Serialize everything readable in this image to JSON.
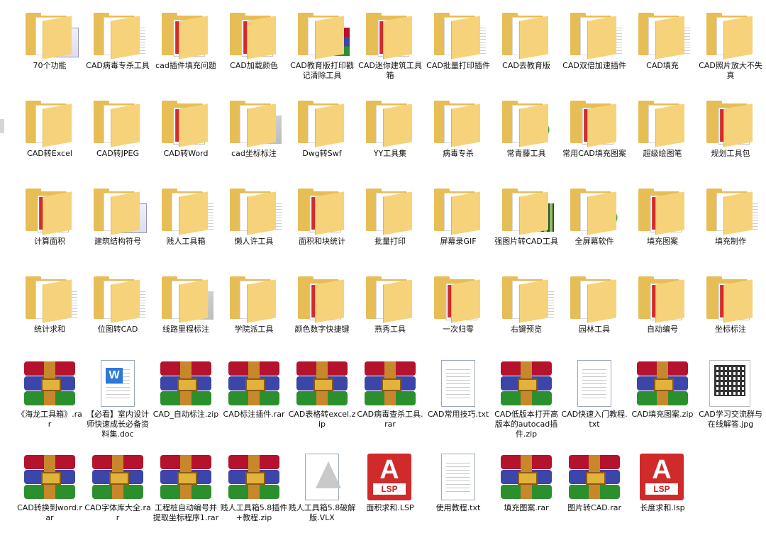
{
  "rows": [
    [
      {
        "label": "70个功能",
        "type": "folder",
        "deco": "screenshot"
      },
      {
        "label": "CAD病毒专杀工具",
        "type": "folder",
        "deco": "doc"
      },
      {
        "label": "cad插件填充问题",
        "type": "folder-acad",
        "tag": "CTB"
      },
      {
        "label": "CAD加载颜色",
        "type": "folder-acad",
        "tag": "LSP"
      },
      {
        "label": "CAD教育版打印戳记清除工具",
        "type": "folder",
        "deco": "winrar"
      },
      {
        "label": "CAD迷你建筑工具箱",
        "type": "folder-acad",
        "tag": "CUIX"
      },
      {
        "label": "CAD批量打印插件",
        "type": "folder",
        "deco": "lines"
      },
      {
        "label": "CAD去教育版",
        "type": "folder",
        "deco": "dot"
      },
      {
        "label": "CAD双倍加速插件",
        "type": "folder",
        "deco": "lines"
      },
      {
        "label": "CAD填充",
        "type": "folder",
        "deco": "list"
      },
      {
        "label": "CAD照片放大不失真",
        "type": "folder",
        "deco": "dot"
      }
    ],
    [
      {
        "label": "CAD转Excel",
        "type": "folder",
        "deco": "people"
      },
      {
        "label": "CAD转JPEG",
        "type": "folder",
        "deco": "dot"
      },
      {
        "label": "CAD转Word",
        "type": "folder-acad",
        "tag": "ARX"
      },
      {
        "label": "cad坐标标注",
        "type": "folder",
        "deco": "acadgrey"
      },
      {
        "label": "Dwg转Swf",
        "type": "folder",
        "deco": "gear"
      },
      {
        "label": "YY工具集",
        "type": "folder",
        "deco": "dot"
      },
      {
        "label": "病毒专杀",
        "type": "folder",
        "deco": "plain"
      },
      {
        "label": "常青藤工具",
        "type": "folder",
        "deco": "green"
      },
      {
        "label": "常用CAD填充图案",
        "type": "folder-acad",
        "tag": "PAT"
      },
      {
        "label": "超级绘图笔",
        "type": "folder",
        "deco": "dot"
      },
      {
        "label": "规划工具包",
        "type": "folder-acad",
        "tag": "LSP"
      }
    ],
    [
      {
        "label": "计算面积",
        "type": "folder-acad",
        "tag": "LSP"
      },
      {
        "label": "建筑结构符号",
        "type": "folder",
        "deco": "screenshot"
      },
      {
        "label": "贱人工具箱",
        "type": "folder",
        "deco": "lines"
      },
      {
        "label": "懒人许工具",
        "type": "folder",
        "deco": "lines"
      },
      {
        "label": "面积和块统计",
        "type": "folder-acad",
        "tag": ""
      },
      {
        "label": "批量打印",
        "type": "folder",
        "deco": "dot"
      },
      {
        "label": "屏幕录GIF",
        "type": "folder",
        "deco": "dot"
      },
      {
        "label": "强图片转CAD工具",
        "type": "folder",
        "deco": "photo"
      },
      {
        "label": "全屏幕软件",
        "type": "folder",
        "deco": "green"
      },
      {
        "label": "填充图案",
        "type": "folder-acad",
        "tag": "PAT"
      },
      {
        "label": "填充制作",
        "type": "folder",
        "deco": "lines"
      }
    ],
    [
      {
        "label": "统计求和",
        "type": "folder",
        "deco": "lines"
      },
      {
        "label": "位图转CAD",
        "type": "folder",
        "deco": "doc"
      },
      {
        "label": "线路里程标注",
        "type": "folder",
        "deco": "acadgrey"
      },
      {
        "label": "学院派工具",
        "type": "folder",
        "deco": "dot"
      },
      {
        "label": "颜色数字快捷键",
        "type": "folder-acad",
        "tag": "LSP"
      },
      {
        "label": "燕秀工具",
        "type": "folder",
        "deco": "reddot"
      },
      {
        "label": "一次归零",
        "type": "folder-acad",
        "tag": "LSP"
      },
      {
        "label": "右键预览",
        "type": "folder",
        "deco": "lines"
      },
      {
        "label": "园林工具",
        "type": "folder",
        "deco": "dot"
      },
      {
        "label": "自动编号",
        "type": "folder-acad",
        "tag": "LSP"
      },
      {
        "label": "坐标标注",
        "type": "folder-acad",
        "tag": ""
      }
    ],
    [
      {
        "label": "《海龙工具箱》.rar",
        "type": "rar"
      },
      {
        "label": "【必看】室内设计师快速成长必备资料集.doc",
        "type": "doc"
      },
      {
        "label": "CAD_自动标注.zip",
        "type": "rar"
      },
      {
        "label": "CAD标注插件.rar",
        "type": "rar"
      },
      {
        "label": "CAD表格转excel.zip",
        "type": "rar"
      },
      {
        "label": "CAD病毒查杀工具.rar",
        "type": "rar"
      },
      {
        "label": "CAD常用技巧.txt",
        "type": "txt"
      },
      {
        "label": "CAD低版本打开高版本的autocad插件.zip",
        "type": "rar"
      },
      {
        "label": "CAD快速入门教程.txt",
        "type": "txt"
      },
      {
        "label": "CAD填充图案.zip",
        "type": "rar"
      },
      {
        "label": "CAD学习交流群与在线解答.jpg",
        "type": "qr"
      }
    ],
    [
      {
        "label": "CAD转换到word.rar",
        "type": "rar"
      },
      {
        "label": "CAD字体库大全.rar",
        "type": "rar"
      },
      {
        "label": "工程桩自动编号并提取坐标程序1.rar",
        "type": "rar"
      },
      {
        "label": "贱人工具箱5.8插件+教程.zip",
        "type": "rar"
      },
      {
        "label": "贱人工具箱5.8破解版.VLX",
        "type": "vlx"
      },
      {
        "label": "面积求和.LSP",
        "type": "lsp",
        "tag": "LSP"
      },
      {
        "label": "使用教程.txt",
        "type": "txt"
      },
      {
        "label": "填充图案.rar",
        "type": "rar"
      },
      {
        "label": "图片转CAD.rar",
        "type": "rar"
      },
      {
        "label": "长度求和.lsp",
        "type": "lsp",
        "tag": "LSP"
      }
    ]
  ]
}
